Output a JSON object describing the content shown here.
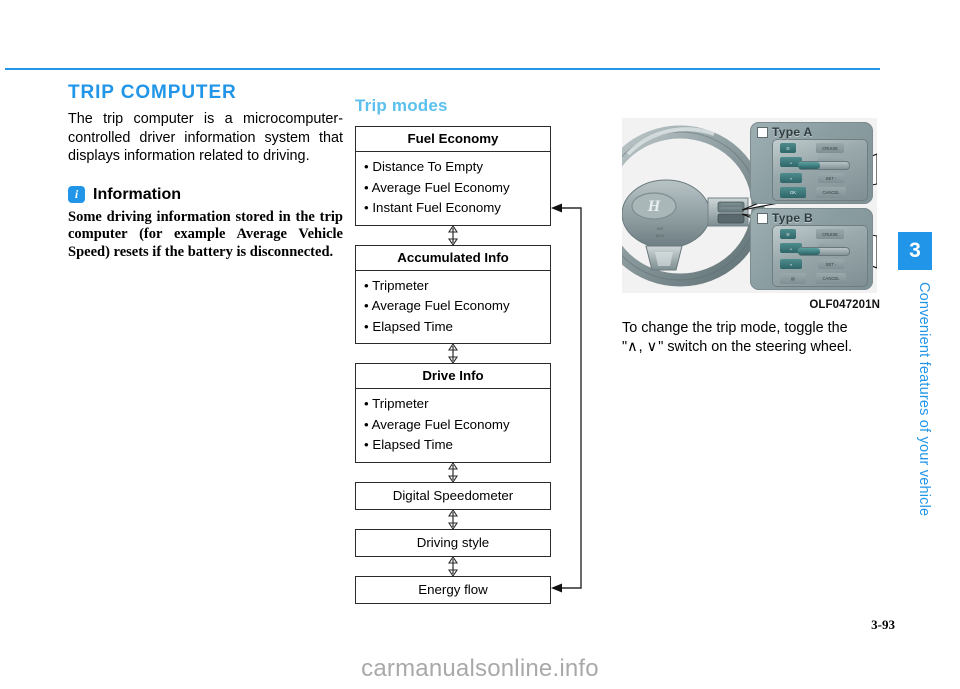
{
  "page": {
    "number": "3-93",
    "watermark": "carmanualsonline.info"
  },
  "side_tab": {
    "chapter": "3",
    "chapter_title": "Convenient features of your vehicle",
    "color": "#2196e8"
  },
  "section": {
    "title": "TRIP COMPUTER",
    "title_color": "#2196e8",
    "intro": "The trip computer is a microcomputer-controlled driver information system that displays information related to driving."
  },
  "information_note": {
    "icon": "info-icon",
    "heading": "Information",
    "body": "Some driving information stored in the trip computer (for example Average Vehicle Speed) resets if the battery is disconnected."
  },
  "trip_modes": {
    "title": "Trip modes",
    "title_color": "#5bc0ee",
    "boxes": [
      {
        "header": "Fuel Economy",
        "items": [
          "Distance To Empty",
          "Average Fuel Economy",
          "Instant Fuel Economy"
        ]
      },
      {
        "header": "Accumulated Info",
        "items": [
          "Tripmeter",
          "Average Fuel Economy",
          "Elapsed Time"
        ]
      },
      {
        "header": "Drive Info",
        "items": [
          "Tripmeter",
          "Average Fuel Economy",
          "Elapsed Time"
        ]
      },
      {
        "header": "Digital Speedometer",
        "items": []
      },
      {
        "header": "Driving style",
        "items": []
      },
      {
        "header": "Energy flow",
        "items": []
      }
    ]
  },
  "figure": {
    "caption": "OLF047201N",
    "description": "To change the trip mode, toggle the \" ∧ , ∨ \" switch on the steering wheel.",
    "description_part1": "To change the trip mode, toggle the",
    "description_quote_open": "\"",
    "description_up_chevron": "∧",
    "description_comma": ",",
    "description_down_chevron": "∨",
    "description_quote_close": "\"",
    "description_part2": "switch on the steering wheel.",
    "panels": [
      {
        "label": "Type A",
        "buttons": [
          "CRUISE",
          "SET +",
          "SET -",
          "OK",
          "CANCEL"
        ]
      },
      {
        "label": "Type B",
        "buttons": [
          "CRUISE",
          "SET +",
          "SET -",
          "TRIP",
          "CANCEL"
        ]
      }
    ],
    "brand": "HYUNDAI"
  }
}
